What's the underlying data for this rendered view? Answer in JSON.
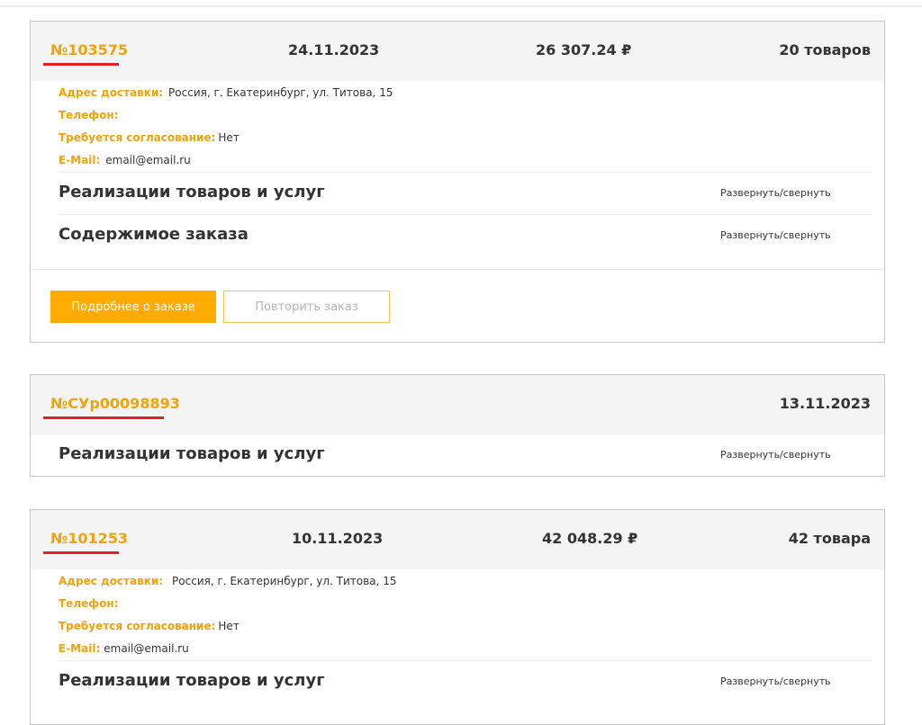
{
  "orders": [
    {
      "number": "№103575",
      "date": "24.11.2023",
      "total": "26 307.24 ₽",
      "items_count": "20 товаров",
      "address_label": "Адрес доставки:",
      "address": "Россия, г. Екатеринбург, ул. Титова, 15",
      "phone_label": "Телефон:",
      "approval_label": "Требуется согласование:",
      "approval": "Нет",
      "email_label": "E-Mail:",
      "email": "email@email.ru",
      "sections": [
        {
          "title": "Реализации товаров и услуг",
          "toggle": "Развернуть/свернуть"
        },
        {
          "title": "Содержимое заказа",
          "toggle": "Развернуть/свернуть"
        }
      ],
      "details_button": "Подробнее о заказе",
      "repeat_button": "Повторить заказ"
    },
    {
      "number": "№СУр00098893",
      "date": "13.11.2023",
      "sections": [
        {
          "title": "Реализации товаров и услуг",
          "toggle": "Развернуть/свернуть"
        }
      ]
    },
    {
      "number": "№101253",
      "date": "10.11.2023",
      "total": "42 048.29 ₽",
      "items_count": "42 товара",
      "address_label": "Адрес доставки:",
      "address": "Россия, г. Екатеринбург, ул. Титова, 15",
      "phone_label": "Телефон:",
      "approval_label": "Требуется согласование:",
      "approval": "Нет",
      "email_label": "E-Mail:",
      "email": "email@email.ru",
      "sections": [
        {
          "title": "Реализации товаров и услуг",
          "toggle": "Развернуть/свернуть"
        }
      ]
    }
  ],
  "colors": {
    "accent_orange": "#f0a30a",
    "button_orange": "#ffab00",
    "underline_red": "#e31e24",
    "header_bg": "#f4f4f4"
  }
}
